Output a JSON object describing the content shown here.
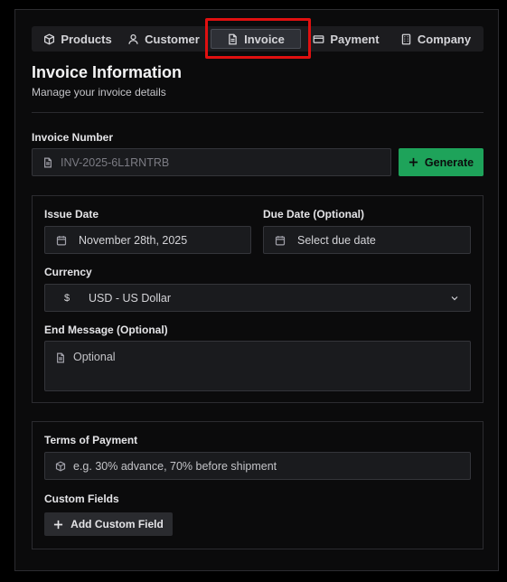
{
  "tabs": [
    {
      "label": "Products",
      "icon": "box-icon"
    },
    {
      "label": "Customer",
      "icon": "user-icon"
    },
    {
      "label": "Invoice",
      "icon": "document-icon",
      "active": true
    },
    {
      "label": "Payment",
      "icon": "credit-card-icon"
    },
    {
      "label": "Company",
      "icon": "building-icon"
    }
  ],
  "header": {
    "title": "Invoice Information",
    "subtitle": "Manage your invoice details"
  },
  "invoice_number": {
    "label": "Invoice Number",
    "value": "INV-2025-6L1RNTRB",
    "generate_label": "Generate"
  },
  "issue_date": {
    "label": "Issue Date",
    "value": "November 28th, 2025"
  },
  "due_date": {
    "label": "Due Date (Optional)",
    "placeholder": "Select due date"
  },
  "currency": {
    "label": "Currency",
    "symbol": "$",
    "value": "USD - US Dollar"
  },
  "end_message": {
    "label": "End Message (Optional)",
    "placeholder": "Optional"
  },
  "terms": {
    "label": "Terms of Payment",
    "placeholder": "e.g. 30% advance, 70% before shipment"
  },
  "custom_fields": {
    "label": "Custom Fields",
    "add_label": "Add Custom Field"
  },
  "colors": {
    "accent": "#1ea35a",
    "highlight": "#e01010",
    "background": "#0b0b0c"
  }
}
